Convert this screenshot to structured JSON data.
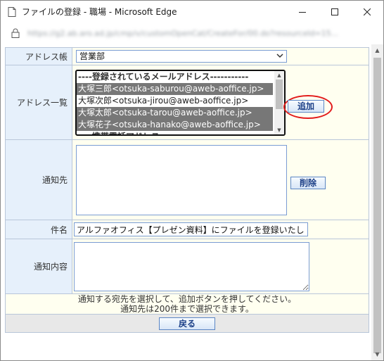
{
  "window": {
    "title": "ファイルの登録 - 職場 - Microsoft Edge",
    "url": "https://g2.ab.aro.ad.jp/cmp/v/customOpenCat/CreateFor/00.do?resourceId=15..."
  },
  "form": {
    "address_book_label": "アドレス帳",
    "address_book_value": "営業部",
    "address_list_label": "アドレス一覧",
    "address_items": [
      {
        "text": "----登録されているメールアドレス-----------",
        "selected": false,
        "header": true
      },
      {
        "text": "大塚三郎<otsuka-saburou@aweb-aoffice.jp>",
        "selected": true,
        "header": false
      },
      {
        "text": "大塚次郎<otsuka-jirou@aweb-aoffice.jp>",
        "selected": false,
        "header": false
      },
      {
        "text": "大塚太郎<otsuka-tarou@aweb-aoffice.jp>",
        "selected": true,
        "header": false
      },
      {
        "text": "大塚花子<otsuka-hanako@aweb-aoffice.jp>",
        "selected": true,
        "header": false
      },
      {
        "text": "----携帯電話アドレス-------------------",
        "selected": false,
        "header": true
      }
    ],
    "add_button": "追加",
    "notify_to_label": "通知先",
    "delete_button": "削除",
    "subject_label": "件名",
    "subject_value": "アルファオフィス【プレゼン資料】にファイルを登録いたしました",
    "body_label": "通知内容",
    "notice_line1": "通知する宛先を選択して、追加ボタンを押してください。",
    "notice_line2": "通知先は200件まで選択できます。",
    "back_button": "戻る"
  }
}
